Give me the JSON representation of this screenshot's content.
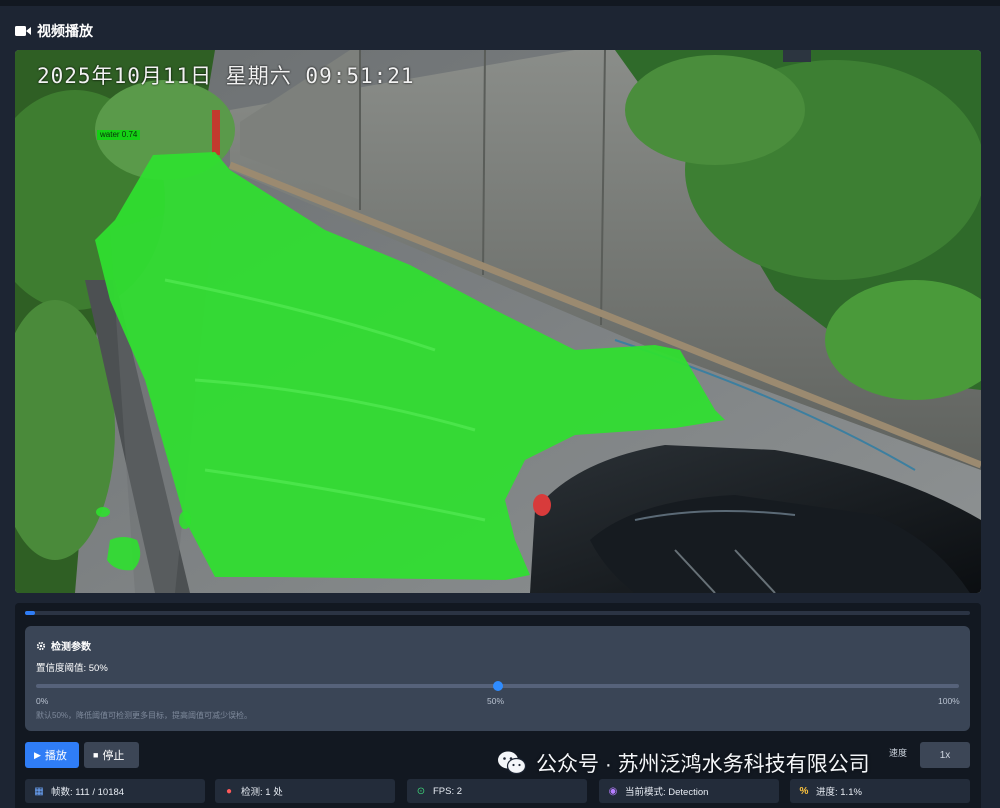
{
  "panel": {
    "title": "视频播放"
  },
  "video": {
    "osd_timestamp": "2025年10月11日 星期六 09:51:21",
    "mask_label": "water 0.74"
  },
  "progress": {
    "fraction": 0.011
  },
  "params": {
    "title": "检测参数",
    "threshold_label": "置信度阈值: 50%",
    "threshold_value": 0.5,
    "tick_min": "0%",
    "tick_mid": "50%",
    "tick_max": "100%",
    "hint": "默认50%，降低阈值可检测更多目标，提高阈值可减少误检。"
  },
  "buttons": {
    "play": "播放",
    "stop": "停止",
    "right_label": "1x",
    "edge_label": "速度"
  },
  "stats": {
    "frames": "帧数: 111 / 10184",
    "detections": "检测: 1 处",
    "fps": "FPS: 2",
    "mode": "当前模式: Detection",
    "progress": "进度: 1.1%"
  },
  "icons": {
    "title": "video-camera-icon",
    "params": "gear-icon",
    "play": "play-icon",
    "stop": "stop-icon",
    "frames": "film-icon",
    "detections": "drop-icon",
    "fps": "check-circle-icon",
    "mode": "eye-icon",
    "progress": "percent-icon"
  },
  "colors": {
    "accent": "#2f7df6",
    "mask": "#2fe02f",
    "panel": "#1d2533"
  },
  "watermark": {
    "text": "公众号 · 苏州泛鸿水务科技有限公司"
  }
}
